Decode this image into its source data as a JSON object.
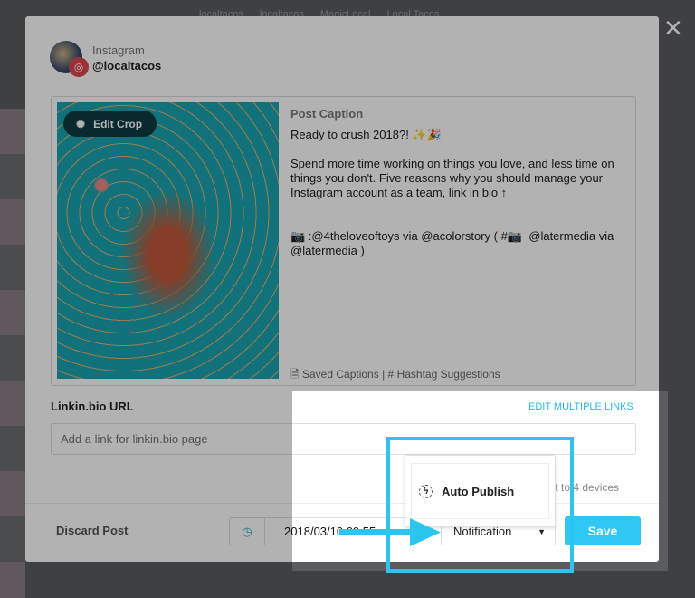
{
  "background": {
    "tabs": [
      "localtacos",
      "localtacos",
      "MagicLocal",
      "Local Tacos"
    ]
  },
  "header": {
    "network": "Instagram",
    "handle": "@localtacos",
    "close": "✕"
  },
  "media": {
    "edit_crop": "Edit Crop"
  },
  "caption": {
    "heading": "Post Caption",
    "text": "Ready to crush 2018?! ✨🎉\n\nSpend more time working on things you love, and less time on things you don't. Five reasons why you should manage your Instagram account as a team, link in bio ↑\n\n\n📷 :@4theloveoftoys via @acolorstory ( #📷  @latermedia via @latermedia )",
    "saved": "Saved Captions",
    "sep": "|",
    "hashtags": "Hashtag Suggestions"
  },
  "linkin": {
    "label": "Linkin.bio URL",
    "edit_multiple": "EDIT MULTIPLE LINKS",
    "placeholder": "Add a link for linkin.bio page"
  },
  "devices_note": "sent to 4 devices",
  "footer": {
    "discard": "Discard Post",
    "datetime": "2018/03/10 09:55 am",
    "mode": "Notification",
    "save": "Save"
  },
  "dropdown": {
    "options": [
      "Auto Publish"
    ]
  },
  "colors": {
    "accent": "#2fc8f4",
    "highlight": "#2ac6f0",
    "instagram": "#e0454f"
  }
}
